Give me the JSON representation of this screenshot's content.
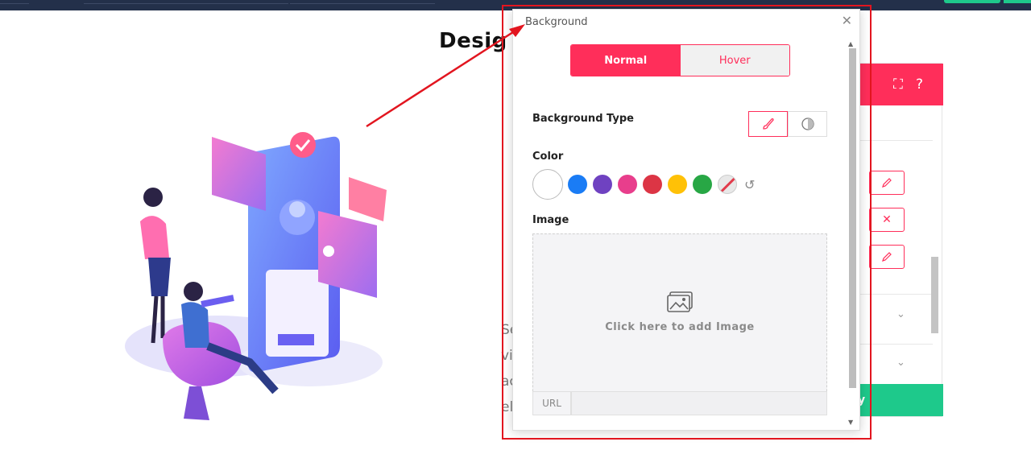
{
  "page": {
    "heading": "Desig"
  },
  "background_fragments": [
    "Se",
    "vi",
    "ac",
    "el"
  ],
  "popover": {
    "title": "Background",
    "close_icon": "close-icon",
    "tabs": [
      {
        "label": "Normal",
        "active": true
      },
      {
        "label": "Hover",
        "active": false
      }
    ],
    "background_type_label": "Background Type",
    "background_type_options": [
      "brush-icon",
      "gradient-icon"
    ],
    "color_label": "Color",
    "colors": [
      "#ffffff",
      "#1a7cf5",
      "#6f42c1",
      "#e83e8c",
      "#dc3545",
      "#ffc107",
      "#28a745",
      "none"
    ],
    "image_label": "Image",
    "image_placeholder": "Click here to add Image",
    "url_label": "URL"
  },
  "side_panel": {
    "accent": "#ff2e5a",
    "icons": [
      "expand-icon",
      "help-icon"
    ],
    "row_actions": [
      "edit-icon",
      "close-icon",
      "edit-icon"
    ],
    "footer_text": "y"
  },
  "colors": {
    "accent": "#ff2e5a",
    "highlight": "#e2151f",
    "success": "#1ec98b",
    "topbar": "#23304a"
  }
}
